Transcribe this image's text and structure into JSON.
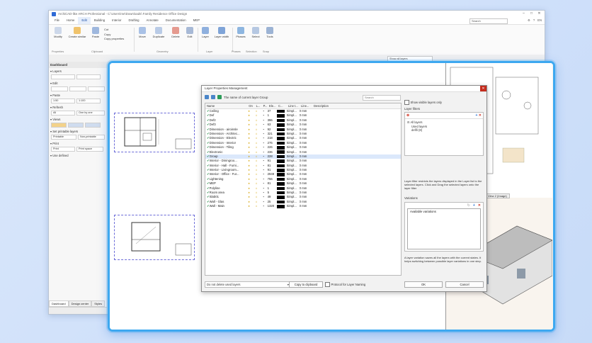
{
  "app": {
    "title": "ArchiCAD-like ARCH Professional - C:\\Users\\me\\Downloads\\  Family Residence Office Design",
    "menus": [
      "File",
      "Home",
      "Edit",
      "Building",
      "Interior",
      "Drafting",
      "Annotate",
      "Documentation",
      "MEP"
    ],
    "active_menu": "Edit",
    "search_placeholder": "Search",
    "right_tools": [
      "⚙",
      "?",
      "EN"
    ]
  },
  "ribbon": {
    "tools": [
      "Modify",
      "Create similar",
      "Paste",
      "Move",
      "Duplicate",
      "Delete",
      "Edit",
      "Layer",
      "Layer width",
      "Phases",
      "Select",
      "Tools"
    ],
    "clipboard_small": [
      "Cut",
      "Copy",
      "Copy properties"
    ],
    "groups": [
      "Properties",
      "Clipboard",
      "Geometry",
      "Layer",
      "Phases",
      "Selection",
      "Snap"
    ]
  },
  "subtool": {
    "layers_combo": "Show all layers"
  },
  "dashboard": {
    "title": "Dashboard",
    "sections": [
      "Layers",
      "Edit",
      "Paste",
      "Refresh",
      "Views",
      "Set printable layers",
      "Print",
      "Use defined"
    ],
    "paste_values": [
      "1:50",
      "1:100"
    ],
    "refresh_options": [
      "All",
      "One by one"
    ],
    "printable_options": [
      "Printable",
      "Non-printable"
    ],
    "print_buttons": [
      "Print",
      "Print space"
    ],
    "tabs": [
      "Dashboard",
      "Design center",
      "Styles"
    ]
  },
  "workspace": {
    "view_label": "View 2 (Image)"
  },
  "dialog": {
    "title": "Layer Properties Management",
    "current_layer_text": "The name of current layer Group",
    "search_placeholder": "Search",
    "columns": [
      "Name",
      "On",
      "L...",
      "P...",
      "Ele...",
      "C...",
      "Line t...",
      "Line...",
      "Description"
    ],
    "layers": [
      {
        "name": "Ceiling",
        "ele": "37",
        "lt": "Simpl...",
        "lw": "0 mm"
      },
      {
        "name": "Def",
        "ele": "1",
        "lt": "Simpl...",
        "lw": "0 mm"
      },
      {
        "name": "Def2",
        "ele": "396",
        "lt": "Simpl...",
        "lw": "0 mm"
      },
      {
        "name": "Def3",
        "ele": "63",
        "lt": "Simpl...",
        "lw": "0 mm"
      },
      {
        "name": "Dimension - airoinsle",
        "ele": "92",
        "lt": "Simpl...",
        "lw": "0 mm"
      },
      {
        "name": "Dimension - Architec...",
        "ele": "321",
        "lt": "Simpl...",
        "lw": "0 mm"
      },
      {
        "name": "Dimension - Electric",
        "ele": "218",
        "lt": "Simpl...",
        "lw": "0 mm"
      },
      {
        "name": "Dimension - Interior",
        "ele": "276",
        "lt": "Simpl...",
        "lw": "0 mm"
      },
      {
        "name": "Dimension - Tiling",
        "ele": "226",
        "lt": "Simpl...",
        "lw": "0 mm"
      },
      {
        "name": "Electronic",
        "ele": "236",
        "lt": "Simpl...",
        "lw": "0 mm"
      },
      {
        "name": "Group",
        "ele": "228",
        "lt": "Simpl...",
        "lw": "0 mm"
      },
      {
        "name": "Interior - Diningroo...",
        "ele": "91",
        "lt": "Simpl...",
        "lw": "0 mm"
      },
      {
        "name": "Interior - Hall - Furni...",
        "ele": "81",
        "lt": "Simpl...",
        "lw": "0 mm"
      },
      {
        "name": "Interior - Livingroom...",
        "ele": "91",
        "lt": "Simpl...",
        "lw": "0 mm"
      },
      {
        "name": "Interior - Office - Fur...",
        "ele": "2949",
        "lt": "Simpl...",
        "lw": "0 mm"
      },
      {
        "name": "Lightening",
        "ele": "756",
        "lt": "Simpl...",
        "lw": "0 mm"
      },
      {
        "name": "MEP",
        "ele": "81",
        "lt": "Simpl...",
        "lw": "0 mm"
      },
      {
        "name": "Polyline",
        "ele": "1",
        "lt": "Simpl...",
        "lw": "0 mm"
      },
      {
        "name": "Room area",
        "ele": "5",
        "lt": "Simpl...",
        "lw": "0 mm"
      },
      {
        "name": "Slab01",
        "ele": "49",
        "lt": "Simpl...",
        "lw": "0 mm"
      },
      {
        "name": "Wall - Glas",
        "ele": "25",
        "lt": "Simpl...",
        "lw": "0 mm"
      },
      {
        "name": "Wall - Main",
        "ele": "1320",
        "lt": "Simpl...",
        "lw": "0 mm"
      }
    ],
    "show_visible": "Show visible layers only",
    "filters_label": "Layer filters",
    "filter_tree": [
      "All layers",
      "Used layers",
      "defifi (8)"
    ],
    "filter_help": "Layer filter restricts the layers displayed in the Layer list to the selected layers. Click and Drag the selected layers onto the layer filter",
    "variations_label": "Variations",
    "available_variations": "Available variations",
    "variation_help": "A layer variation saves all the layers with the current states. It helps switching between possible layer variations in one step.",
    "footer": {
      "delete_option": "Do not delete used layers",
      "copy": "Copy to clipboard",
      "protocol": "Protocol for Layer Naming",
      "ok": "OK",
      "cancel": "Cancel"
    }
  },
  "colors": {
    "accent": "#3da8f0",
    "selection": "#dbe8fb",
    "ribbon_icon": "#4b86c9"
  }
}
